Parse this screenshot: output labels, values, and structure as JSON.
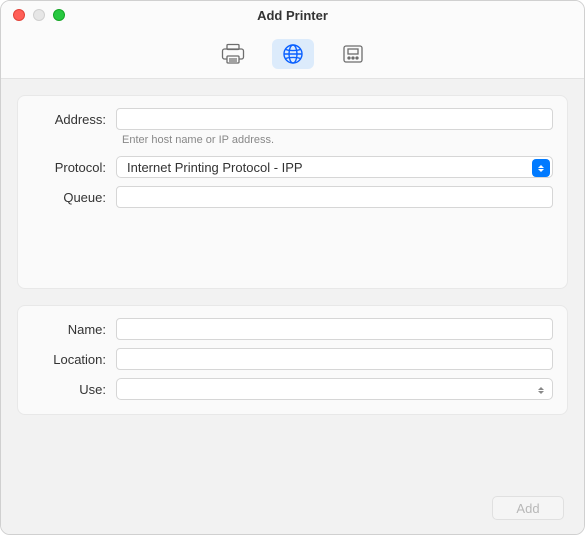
{
  "window": {
    "title": "Add Printer"
  },
  "toolbar": {
    "modes": {
      "default": "printer-icon",
      "ip": "globe-icon",
      "advanced": "printer-advanced-icon"
    },
    "activeMode": "ip"
  },
  "form": {
    "addressLabel": "Address:",
    "addressValue": "",
    "addressHint": "Enter host name or IP address.",
    "protocolLabel": "Protocol:",
    "protocolValue": "Internet Printing Protocol - IPP",
    "queueLabel": "Queue:",
    "queueValue": "",
    "nameLabel": "Name:",
    "nameValue": "",
    "locationLabel": "Location:",
    "locationValue": "",
    "useLabel": "Use:",
    "useValue": ""
  },
  "buttons": {
    "add": "Add"
  },
  "colors": {
    "accent": "#007aff"
  }
}
